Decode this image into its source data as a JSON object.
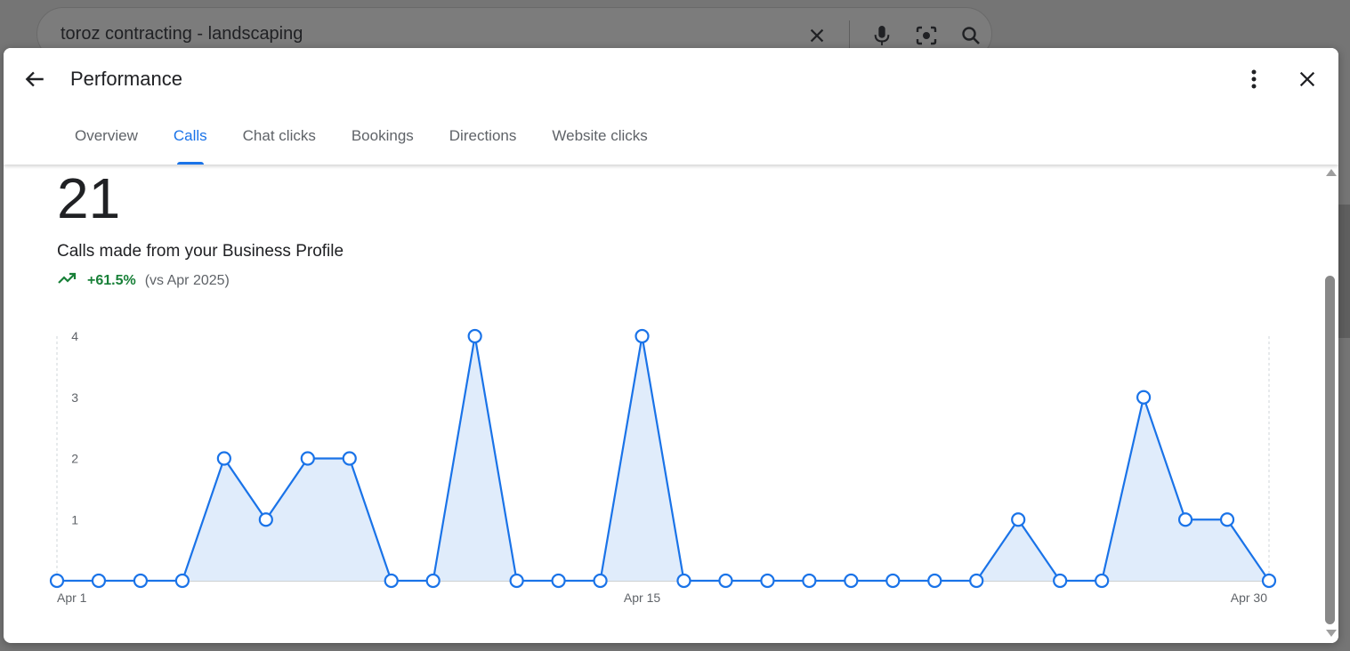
{
  "search": {
    "query": "toroz contracting - landscaping"
  },
  "dialog": {
    "title": "Performance",
    "tabs": [
      "Overview",
      "Calls",
      "Chat clicks",
      "Bookings",
      "Directions",
      "Website clicks"
    ],
    "active_tab": "Calls"
  },
  "metric": {
    "value": "21",
    "label": "Calls made from your Business Profile",
    "change": "+61.5%",
    "comparison": "(vs Apr 2025)"
  },
  "colors": {
    "accent": "#1a73e8",
    "positive": "#188038",
    "fill": "#e0ecfb"
  },
  "chart_data": {
    "type": "area",
    "x": [
      1,
      2,
      3,
      4,
      5,
      6,
      7,
      8,
      9,
      10,
      11,
      12,
      13,
      14,
      15,
      16,
      17,
      18,
      19,
      20,
      21,
      22,
      23,
      24,
      25,
      26,
      27,
      28,
      29,
      30
    ],
    "values": [
      0,
      0,
      0,
      0,
      2,
      1,
      2,
      2,
      0,
      0,
      4,
      0,
      0,
      0,
      4,
      0,
      0,
      0,
      0,
      0,
      0,
      0,
      0,
      1,
      0,
      0,
      3,
      1,
      1,
      0
    ],
    "x_tick_labels": [
      {
        "x": 1,
        "label": "Apr 1"
      },
      {
        "x": 15,
        "label": "Apr 15"
      },
      {
        "x": 30,
        "label": "Apr 30"
      }
    ],
    "y_ticks": [
      1,
      2,
      3,
      4
    ],
    "ylim": [
      0,
      4
    ],
    "grid": false,
    "markers": true
  }
}
